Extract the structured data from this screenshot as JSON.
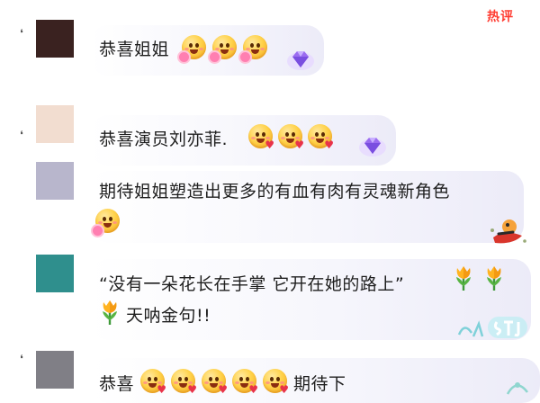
{
  "header": {
    "hot_tag": "热评"
  },
  "comments": [
    {
      "avatar_color": "#3a2220",
      "text": "恭喜姐姐"
    },
    {
      "avatar_color": "#f2ddd0",
      "text": "恭喜演员刘亦菲."
    },
    {
      "avatar_color": "#b8b6cc",
      "text": "期待姐姐塑造出更多的有血有肉有灵魂新角色"
    },
    {
      "avatar_color": "#2f8f8d",
      "text_line1": "“没有一朵花长在手掌 它开在她的路上”",
      "text_line2": "天呐金句!!"
    },
    {
      "avatar_color": "#807f86",
      "text_a": "恭喜",
      "text_b": "期待下"
    }
  ],
  "icons": {
    "emoji": "smiley-emoji-icon",
    "flower_emoji": "smiley-flower-emoji-icon",
    "heart_emoji": "smiley-heart-emoji-icon",
    "tulip": "tulip-icon",
    "diamond": "diamond-badge-icon",
    "fan_badge": "fan-badge-icon"
  },
  "colors": {
    "accent": "#ff3b30",
    "bubble_tint": "#ecebf8",
    "text": "#1e1e1e"
  }
}
